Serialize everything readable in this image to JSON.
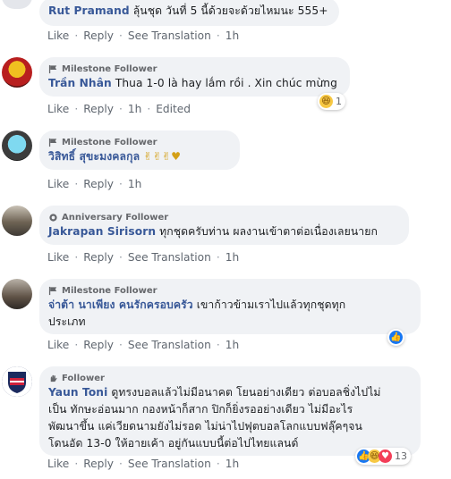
{
  "actions": {
    "like": "Like",
    "reply": "Reply",
    "translate": "See Translation",
    "dot": "·",
    "edited": "Edited"
  },
  "comments": [
    {
      "name": "Rut Pramand",
      "text": "ลุ้นชุด วันที่ 5 นี้ด้วยจะด้วยไหมนะ 555+",
      "time": "1h"
    },
    {
      "badge": "Milestone Follower",
      "name": "Trần Nhân",
      "text": "Thua 1-0 là hay lắm rồi . Xin chúc mừng",
      "time": "1h",
      "reaction_count": "1"
    },
    {
      "badge": "Milestone Follower",
      "name": "วิสิทธิ์ สุขะมงคลกุล",
      "text": "✌✌✌♥",
      "time": "1h"
    },
    {
      "badge": "Anniversary Follower",
      "name": "Jakrapan Sirisorn",
      "text": "ทุกชุดครับท่าน ผลงานเข้าตาต่อเนื่องเลยนายก",
      "time": "1h"
    },
    {
      "badge": "Milestone Follower",
      "name": "จ่าต้า นาเพียง คนรักครอบครัว",
      "text_line1": "เขาก้าวข้ามเราไปแล้วทุกชุดทุก",
      "text_line2": "ประเภท",
      "time": "1h"
    },
    {
      "badge": "Follower",
      "name": "Yaun Toni",
      "text_line1": "ดูทรงบอลแล้วไม่มีอนาคต โยนอย่างเดียว ต่อบอลชิ่งไปไม่",
      "text_line2": "เป็น ทักษะอ่อนมาก กองหน้าก็สาก ปิกก็ยิ่งรออย่างเดียว ไม่มีอะไร",
      "text_line3": "พัฒนาขึ้น แค่เวียดนามยังไม่รอด ไม่น่าไปฟุตบอลโลกแบบฟลุ๊คๆจน",
      "text_line4": "โดนอัด 13-0 ให้อายเค้า อยู่กันแบบนี้ต่อไปไทยแลนด์",
      "time": "1h",
      "reaction_count": "13"
    }
  ]
}
